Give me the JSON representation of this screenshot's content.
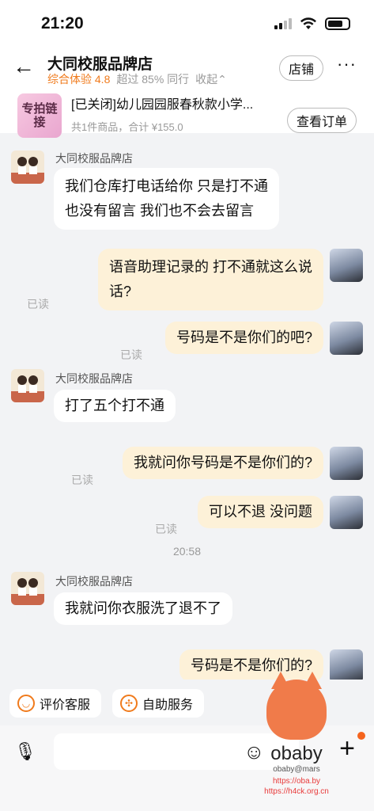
{
  "status": {
    "time": "21:20"
  },
  "header": {
    "title": "大同校服品牌店",
    "rating_label": "综合体验 4.8",
    "beat_label": "超过 85% 同行",
    "collapse_label": "收起⌃",
    "store_button": "店铺",
    "more_label": "···"
  },
  "order": {
    "thumb_text": "专拍链接",
    "title": "[已关闭]幼儿园园服春秋款小学...",
    "summary": "共1件商品，合计 ¥155.0",
    "view_button": "查看订单"
  },
  "messages": [
    {
      "name": "大同校服品牌店",
      "lines": [
        "我们仓库打电话给你 只是打不通",
        "也没有留言 我们也不会去留言"
      ]
    },
    {
      "lines": [
        "语音助理记录的 打不通就这么说",
        "话?"
      ],
      "read": "已读"
    },
    {
      "lines": [
        "号码是不是你们的吧?"
      ],
      "read": "已读"
    },
    {
      "name": "大同校服品牌店",
      "lines": [
        "打了五个打不通"
      ]
    },
    {
      "lines": [
        "我就问你号码是不是你们的?"
      ],
      "read": "已读"
    },
    {
      "lines": [
        "可以不退 没问题"
      ],
      "read": "已读"
    },
    {
      "time": "20:58"
    },
    {
      "name": "大同校服品牌店",
      "lines": [
        "我就问你衣服洗了退不了"
      ]
    },
    {
      "lines": [
        "号码是不是你们的?"
      ]
    }
  ],
  "quick": {
    "rate": "评价客服",
    "self_service": "自助服务"
  },
  "watermark": {
    "big": "obaby",
    "small": "obaby@mars",
    "url1": "https://oba.by",
    "url2": "https://h4ck.org.cn"
  },
  "colors": {
    "accent": "#f07b1d",
    "out_bubble": "#fdf1d8"
  }
}
